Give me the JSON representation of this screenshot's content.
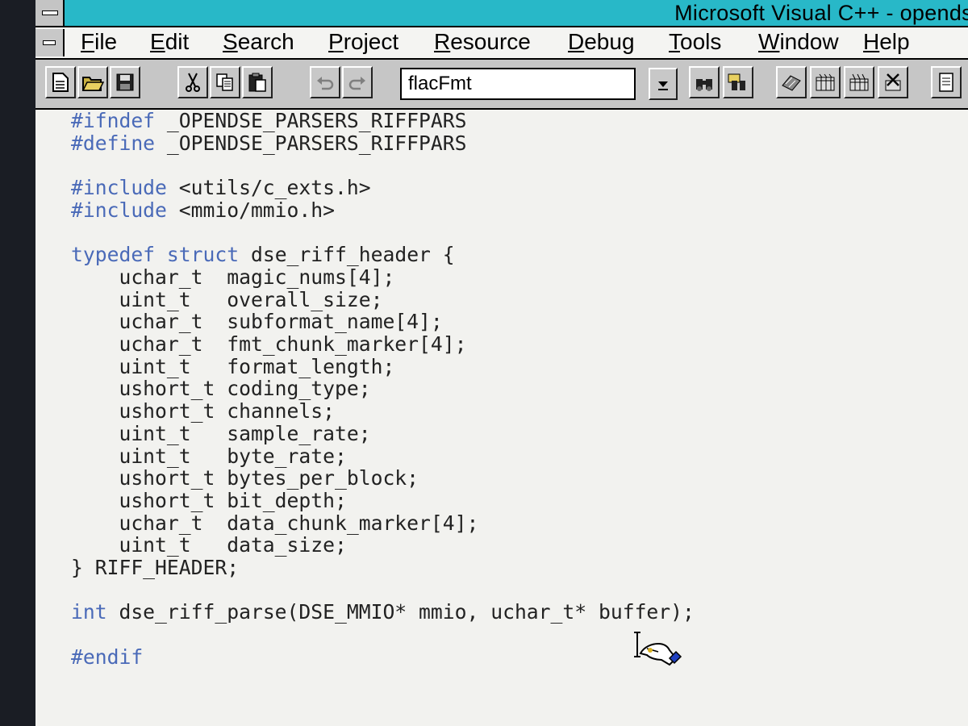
{
  "window": {
    "title": "Microsoft Visual C++ - opends"
  },
  "menu": [
    {
      "label": "File",
      "accel": "F",
      "rest": "ile"
    },
    {
      "label": "Edit",
      "accel": "E",
      "rest": "dit"
    },
    {
      "label": "Search",
      "accel": "S",
      "rest": "earch"
    },
    {
      "label": "Project",
      "accel": "P",
      "rest": "roject"
    },
    {
      "label": "Resource",
      "accel": "R",
      "rest": "esource"
    },
    {
      "label": "Debug",
      "accel": "D",
      "rest": "ebug"
    },
    {
      "label": "Tools",
      "accel": "T",
      "rest": "ools"
    },
    {
      "label": "Window",
      "accel": "W",
      "rest": "indow"
    },
    {
      "label": "Help",
      "accel": "H",
      "rest": "elp"
    }
  ],
  "toolbar": {
    "find_combo_value": "flacFmt",
    "icons": {
      "new": "new-file-icon",
      "open": "open-folder-icon",
      "save": "save-disk-icon",
      "cut": "scissors-icon",
      "copy": "copy-icon",
      "paste": "paste-icon",
      "undo": "undo-icon",
      "redo": "redo-icon",
      "dropdown": "chevron-down-icon",
      "find": "binoculars-icon",
      "find_in_files": "find-in-files-icon",
      "compile": "compile-icon",
      "build": "build-icon",
      "rebuild": "rebuild-all-icon",
      "stop": "stop-build-icon",
      "more": "document-icon"
    }
  },
  "editor": {
    "lines": [
      [
        {
          "t": "#ifndef",
          "k": true
        },
        {
          "t": " _OPENDSE_PARSERS_RIFFPARS"
        }
      ],
      [
        {
          "t": "#define",
          "k": true
        },
        {
          "t": " _OPENDSE_PARSERS_RIFFPARS"
        }
      ],
      [],
      [
        {
          "t": "#include",
          "k": true
        },
        {
          "t": " <utils/c_exts.h>"
        }
      ],
      [
        {
          "t": "#include",
          "k": true
        },
        {
          "t": " <mmio/mmio.h>"
        }
      ],
      [],
      [
        {
          "t": "typedef",
          "k": true
        },
        {
          "t": " "
        },
        {
          "t": "struct",
          "k": true
        },
        {
          "t": " dse_riff_header {"
        }
      ],
      [
        {
          "t": "    uchar_t  magic_nums[4];"
        }
      ],
      [
        {
          "t": "    uint_t   overall_size;"
        }
      ],
      [
        {
          "t": "    uchar_t  subformat_name[4];"
        }
      ],
      [
        {
          "t": "    uchar_t  fmt_chunk_marker[4];"
        }
      ],
      [
        {
          "t": "    uint_t   format_length;"
        }
      ],
      [
        {
          "t": "    ushort_t coding_type;"
        }
      ],
      [
        {
          "t": "    ushort_t channels;"
        }
      ],
      [
        {
          "t": "    uint_t   sample_rate;"
        }
      ],
      [
        {
          "t": "    uint_t   byte_rate;"
        }
      ],
      [
        {
          "t": "    ushort_t bytes_per_block;"
        }
      ],
      [
        {
          "t": "    ushort_t bit_depth;"
        }
      ],
      [
        {
          "t": "    uchar_t  data_chunk_marker[4];"
        }
      ],
      [
        {
          "t": "    uint_t   data_size;"
        }
      ],
      [
        {
          "t": "} RIFF_HEADER;"
        }
      ],
      [],
      [
        {
          "t": "int",
          "k": true
        },
        {
          "t": " dse_riff_parse(DSE_MMIO* mmio, uchar_t* buffer);"
        }
      ],
      [],
      [
        {
          "t": "#endif",
          "k": true
        }
      ]
    ]
  },
  "colors": {
    "titlebar": "#28b8c8",
    "keyword": "#4a6ab8",
    "editor_bg": "#f2f2ef",
    "toolbar_bg": "#c6c6c6"
  }
}
